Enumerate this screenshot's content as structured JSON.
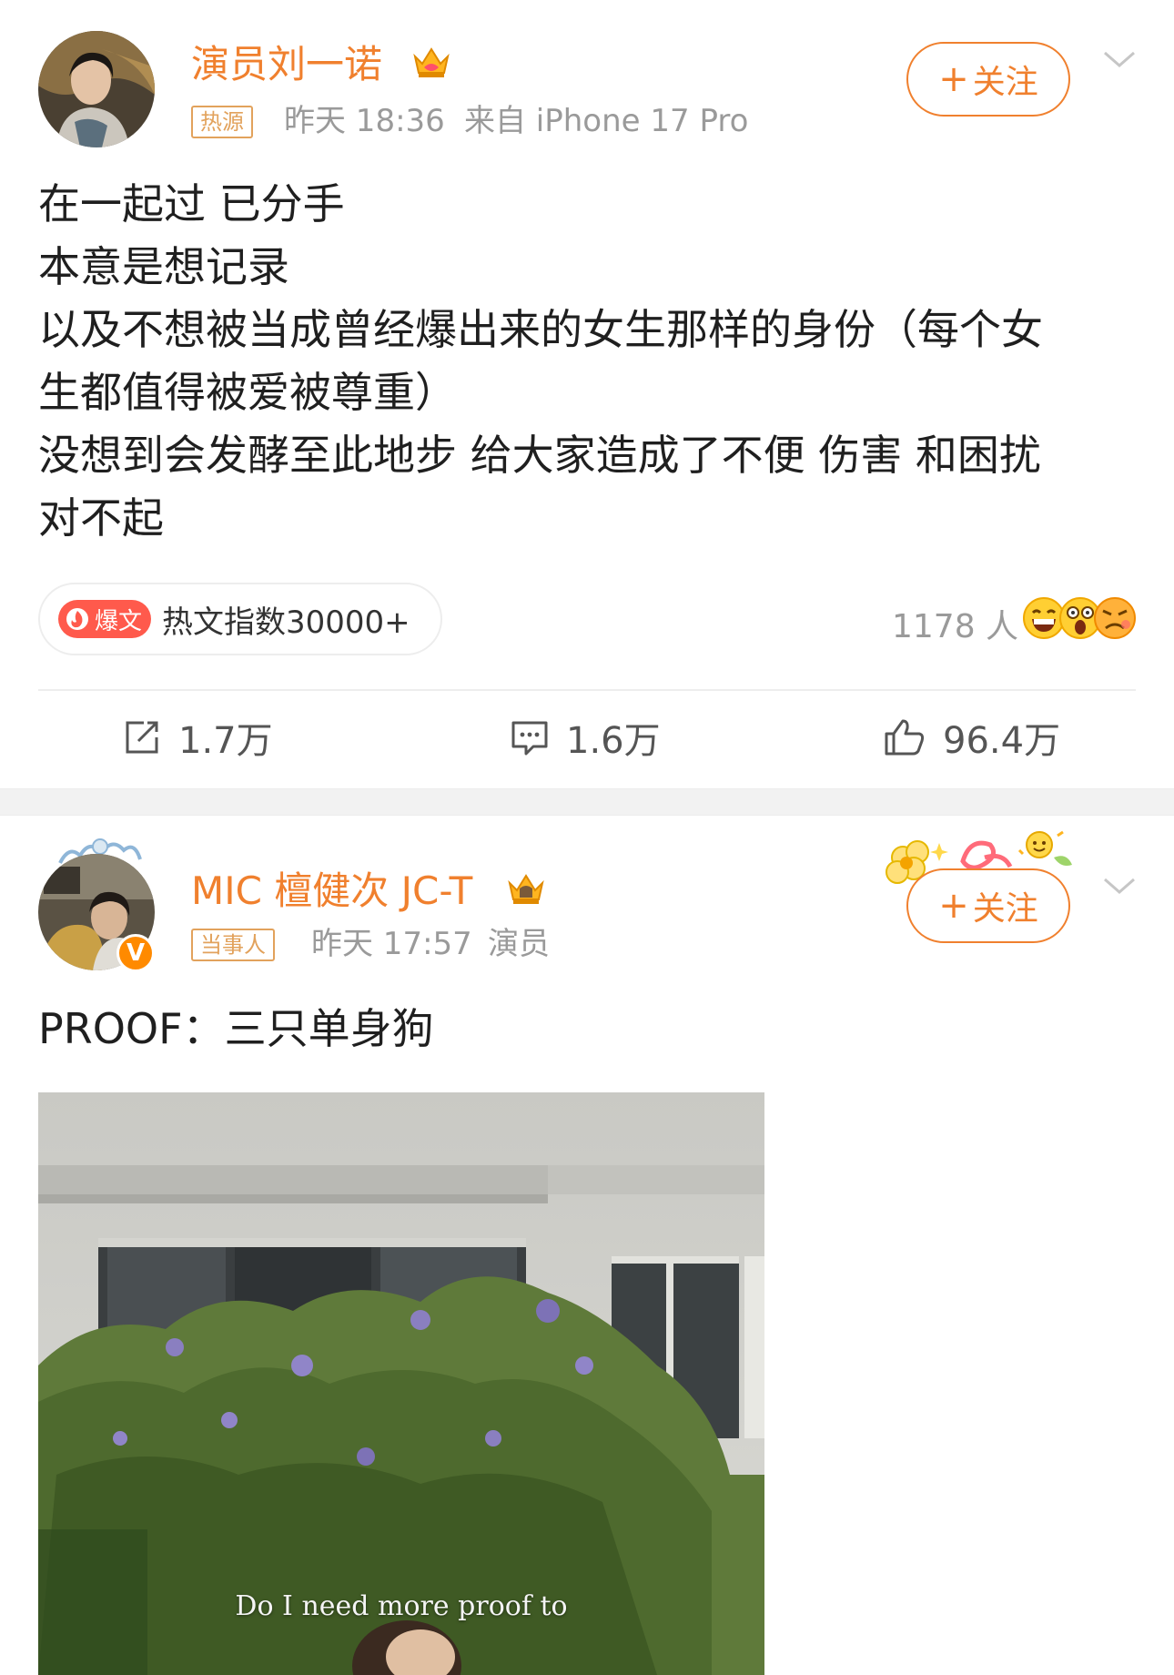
{
  "post1": {
    "author": "演员刘一诺",
    "source_tag": "热源",
    "time": "昨天 18:36",
    "device": "来自 iPhone 17 Pro",
    "follow_label": "关注",
    "content_lines": [
      "在一起过 已分手",
      "本意是想记录",
      "以及不想被当成曾经爆出来的女生那样的身份（每个女",
      "生都值得被爱被尊重）",
      "没想到会发酵至此地步 给大家造成了不便 伤害 和困扰",
      "对不起"
    ],
    "hot_badge": "爆文",
    "hot_index": "热文指数30000+",
    "reaction_count": "1178 人",
    "reaction_icons": [
      "grin-emoji",
      "shocked-emoji",
      "angry-emoji"
    ],
    "reposts": "1.7万",
    "comments": "1.6万",
    "likes": "96.4万"
  },
  "post2": {
    "author": "MIC 檀健次 JC-T",
    "source_tag": "当事人",
    "time": "昨天 17:57",
    "verified_title": "演员",
    "verified_mark": "V",
    "follow_label": "关注",
    "content": "PROOF：三只单身狗",
    "media_caption": "Do I need more proof to"
  },
  "colors": {
    "accent": "#f0802e",
    "tag": "#e2a25c",
    "meta": "#9a9a9a",
    "hot": "#ff5a4c",
    "separator": "#f2f2f2"
  }
}
